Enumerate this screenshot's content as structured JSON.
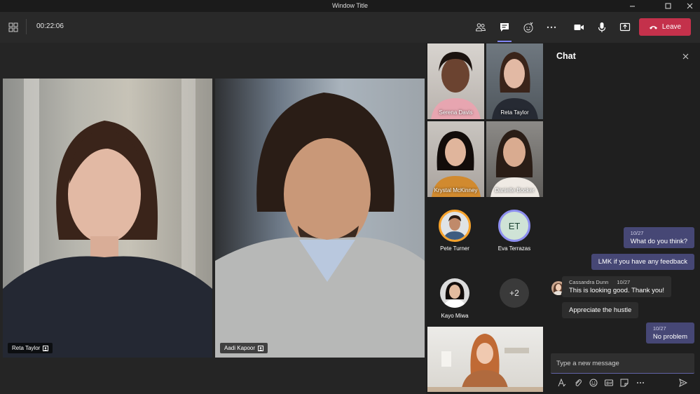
{
  "window": {
    "title": "Window Title"
  },
  "toolbar": {
    "timer": "00:22:06",
    "leave_label": "Leave",
    "leave_color": "#c4314b",
    "accent": "#6264a7"
  },
  "stage": {
    "videos": [
      {
        "name": "Reta Taylor"
      },
      {
        "name": "Aadi Kapoor"
      }
    ]
  },
  "gallery": {
    "tiles": [
      {
        "name": "Serena Davis"
      },
      {
        "name": "Reta Taylor"
      },
      {
        "name": "Krystal McKinney"
      },
      {
        "name": "Danielle Booker"
      }
    ],
    "avatars": [
      {
        "name": "Pete Turner"
      },
      {
        "name": "Eva Terrazas",
        "initials": "ET"
      },
      {
        "name": "Kayo Miwa"
      }
    ],
    "overflow": "+2"
  },
  "chat": {
    "title": "Chat",
    "messages": [
      {
        "time": "10/27",
        "text": "What do you think?"
      },
      {
        "text": "LMK if you have any feedback"
      },
      {
        "author": "Cassandra Dunn",
        "time": "10/27",
        "text": "This is looking good. Thank you!"
      },
      {
        "text": "Appreciate the hustle"
      },
      {
        "time": "10/27",
        "text": "No problem"
      }
    ],
    "compose_placeholder": "Type a new message"
  }
}
